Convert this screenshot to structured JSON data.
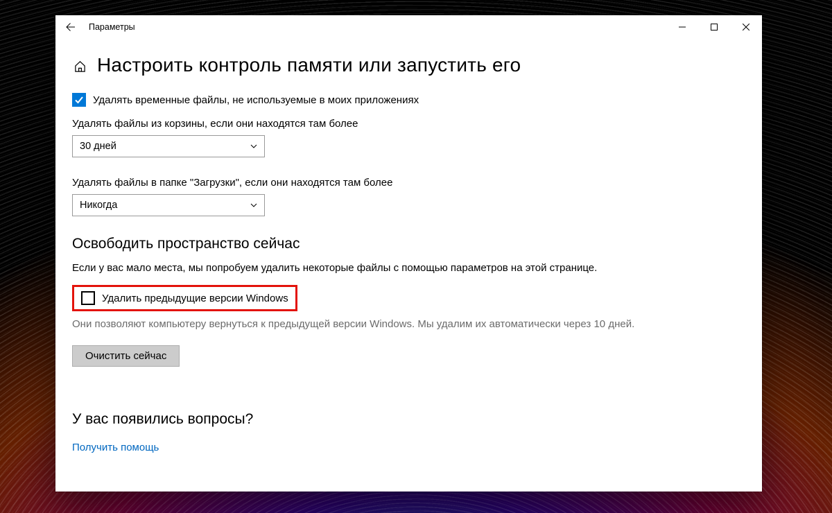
{
  "window": {
    "title": "Параметры"
  },
  "page": {
    "heading": "Настроить контроль памяти или запустить его"
  },
  "tempFilesCheckbox": {
    "label": "Удалять временные файлы, не используемые в моих приложениях",
    "checked": true
  },
  "recycleBin": {
    "label": "Удалять файлы из корзины, если они находятся там более",
    "selected": "30 дней"
  },
  "downloads": {
    "label": "Удалять файлы в папке \"Загрузки\", если они находятся там более",
    "selected": "Никогда"
  },
  "freeNow": {
    "heading": "Освободить пространство сейчас",
    "description": "Если у вас мало места, мы попробуем удалить некоторые файлы с помощью параметров на этой странице.",
    "prevVersionsLabel": "Удалить предыдущие версии Windows",
    "prevVersionsChecked": false,
    "prevVersionsNote": "Они позволяют компьютеру вернуться к предыдущей версии Windows. Мы удалим их автоматически через 10 дней.",
    "cleanButton": "Очистить сейчас"
  },
  "help": {
    "heading": "У вас появились вопросы?",
    "link": "Получить помощь"
  }
}
